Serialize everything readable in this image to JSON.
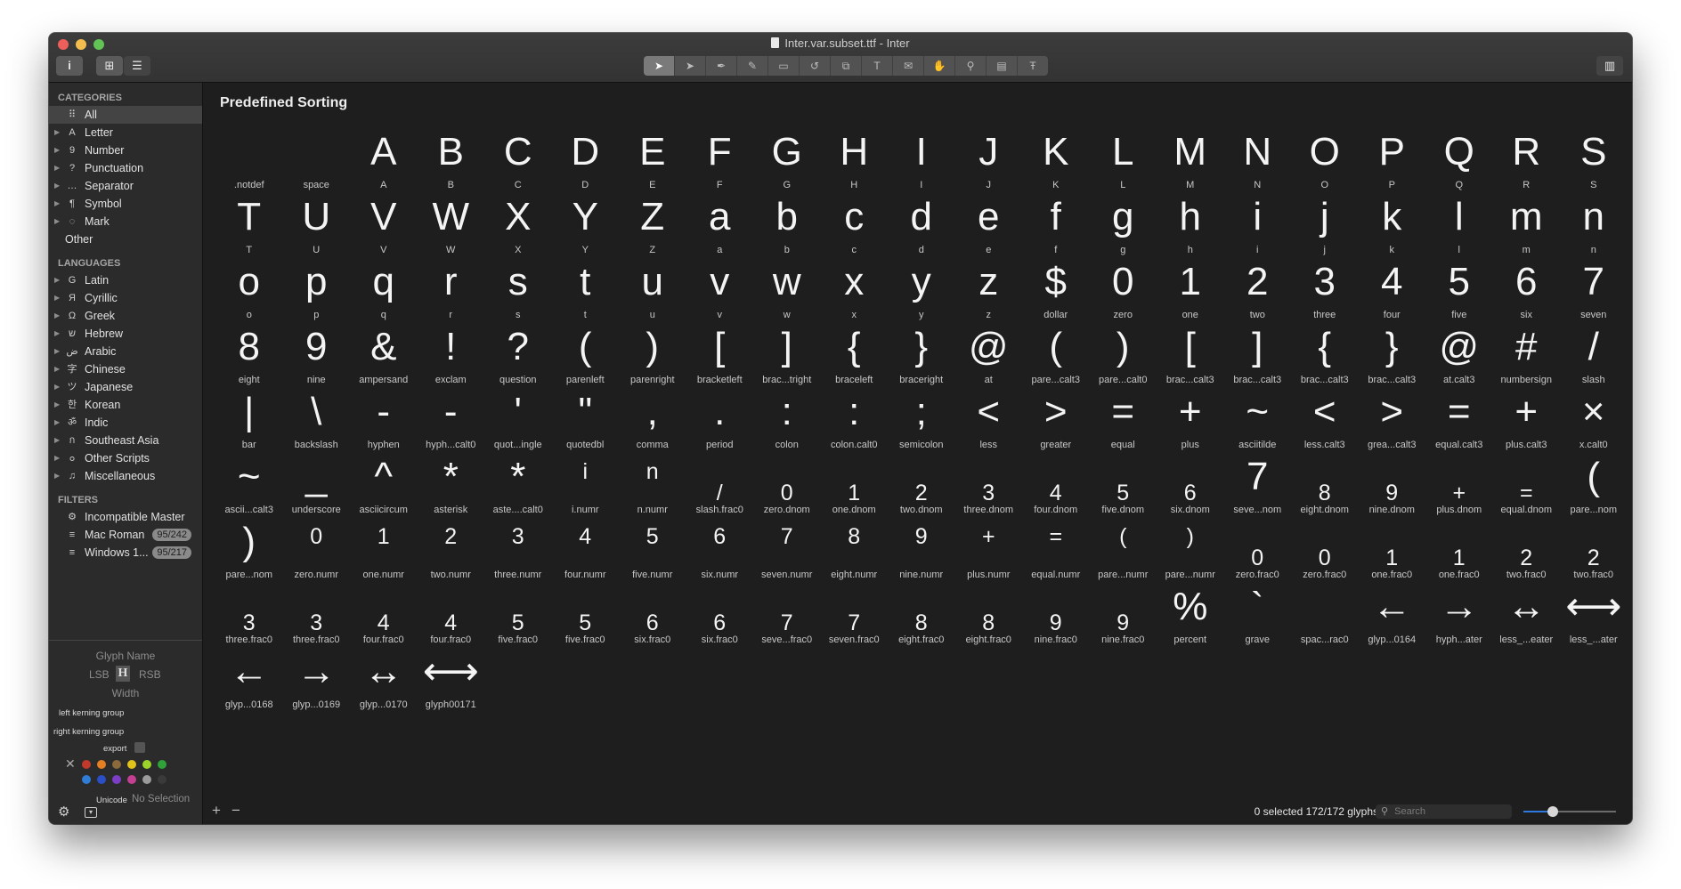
{
  "window": {
    "title": "Inter.var.subset.ttf - Inter"
  },
  "toolbar": {
    "info_label": "i",
    "grid_label": "⊞",
    "list_label": "☰",
    "tools": [
      {
        "name": "select-tool-icon",
        "glyph": "➤",
        "active": true
      },
      {
        "name": "select-all-tool-icon",
        "glyph": "➤",
        "active": false
      },
      {
        "name": "pen-tool-icon",
        "glyph": "✒",
        "active": false
      },
      {
        "name": "pencil-tool-icon",
        "glyph": "✎",
        "active": false
      },
      {
        "name": "rectangle-tool-icon",
        "glyph": "▭",
        "active": false
      },
      {
        "name": "rotate-tool-icon",
        "glyph": "↺",
        "active": false
      },
      {
        "name": "scale-tool-icon",
        "glyph": "⧉",
        "active": false
      },
      {
        "name": "text-tool-icon",
        "glyph": "T",
        "active": false
      },
      {
        "name": "annotation-tool-icon",
        "glyph": "✉",
        "active": false
      },
      {
        "name": "hand-tool-icon",
        "glyph": "✋",
        "active": false
      },
      {
        "name": "zoom-tool-icon",
        "glyph": "⚲",
        "active": false
      },
      {
        "name": "measure-tool-icon",
        "glyph": "▤",
        "active": false
      },
      {
        "name": "type-tool-icon",
        "glyph": "Ŧ",
        "active": false
      }
    ],
    "panel_toggle": "▥"
  },
  "sidebar": {
    "categories_title": "CATEGORIES",
    "categories": [
      {
        "label": "All",
        "icon": "⠿",
        "selected": true,
        "expandable": false
      },
      {
        "label": "Letter",
        "icon": "A",
        "selected": false,
        "expandable": true
      },
      {
        "label": "Number",
        "icon": "9",
        "selected": false,
        "expandable": true
      },
      {
        "label": "Punctuation",
        "icon": "?",
        "selected": false,
        "expandable": true
      },
      {
        "label": "Separator",
        "icon": "…",
        "selected": false,
        "expandable": true
      },
      {
        "label": "Symbol",
        "icon": "¶",
        "selected": false,
        "expandable": true
      },
      {
        "label": "Mark",
        "icon": "◌",
        "selected": false,
        "expandable": true
      }
    ],
    "other_label": "Other",
    "languages_title": "LANGUAGES",
    "languages": [
      {
        "label": "Latin",
        "icon": "G"
      },
      {
        "label": "Cyrillic",
        "icon": "Я"
      },
      {
        "label": "Greek",
        "icon": "Ω"
      },
      {
        "label": "Hebrew",
        "icon": "ש"
      },
      {
        "label": "Arabic",
        "icon": "ض"
      },
      {
        "label": "Chinese",
        "icon": "字"
      },
      {
        "label": "Japanese",
        "icon": "ツ"
      },
      {
        "label": "Korean",
        "icon": "한"
      },
      {
        "label": "Indic",
        "icon": "ॐ"
      },
      {
        "label": "Southeast Asia",
        "icon": "ก"
      },
      {
        "label": "Other Scripts",
        "icon": "ߋ"
      },
      {
        "label": "Miscellaneous",
        "icon": "♫"
      }
    ],
    "filters_title": "FILTERS",
    "filters": [
      {
        "label": "Incompatible Master",
        "icon": "⚙",
        "badge": ""
      },
      {
        "label": "Mac Roman",
        "icon": "≡",
        "badge": "95/242"
      },
      {
        "label": "Windows 1...",
        "icon": "≡",
        "badge": "95/217"
      }
    ]
  },
  "info_panel": {
    "glyph_name": "Glyph Name",
    "lsb": "LSB",
    "rsb": "RSB",
    "width": "Width",
    "left_kerning": "left kerning group",
    "right_kerning": "right kerning group",
    "export_label": "export",
    "unicode_label": "Unicode",
    "unicode_value": "No Selection",
    "color_swatches": [
      "#c0392b",
      "#e67e22",
      "#8a6a3b",
      "#e1c21b",
      "#9bd32b",
      "#2fa33a",
      "#2f7dd6",
      "#2a4fc7",
      "#7c3ec7",
      "#c23f93",
      "#9b9b9b",
      "#3a3a3a"
    ]
  },
  "main": {
    "sort_title": "Predefined Sorting",
    "glyphs": [
      {
        "c": "",
        "n": ".notdef"
      },
      {
        "c": "",
        "n": "space"
      },
      {
        "c": "A",
        "n": "A"
      },
      {
        "c": "B",
        "n": "B"
      },
      {
        "c": "C",
        "n": "C"
      },
      {
        "c": "D",
        "n": "D"
      },
      {
        "c": "E",
        "n": "E"
      },
      {
        "c": "F",
        "n": "F"
      },
      {
        "c": "G",
        "n": "G"
      },
      {
        "c": "H",
        "n": "H"
      },
      {
        "c": "I",
        "n": "I"
      },
      {
        "c": "J",
        "n": "J"
      },
      {
        "c": "K",
        "n": "K"
      },
      {
        "c": "L",
        "n": "L"
      },
      {
        "c": "M",
        "n": "M"
      },
      {
        "c": "N",
        "n": "N"
      },
      {
        "c": "O",
        "n": "O"
      },
      {
        "c": "P",
        "n": "P"
      },
      {
        "c": "Q",
        "n": "Q"
      },
      {
        "c": "R",
        "n": "R"
      },
      {
        "c": "S",
        "n": "S"
      },
      {
        "c": "T",
        "n": "T"
      },
      {
        "c": "U",
        "n": "U"
      },
      {
        "c": "V",
        "n": "V"
      },
      {
        "c": "W",
        "n": "W"
      },
      {
        "c": "X",
        "n": "X"
      },
      {
        "c": "Y",
        "n": "Y"
      },
      {
        "c": "Z",
        "n": "Z"
      },
      {
        "c": "a",
        "n": "a"
      },
      {
        "c": "b",
        "n": "b"
      },
      {
        "c": "c",
        "n": "c"
      },
      {
        "c": "d",
        "n": "d"
      },
      {
        "c": "e",
        "n": "e"
      },
      {
        "c": "f",
        "n": "f"
      },
      {
        "c": "g",
        "n": "g"
      },
      {
        "c": "h",
        "n": "h"
      },
      {
        "c": "i",
        "n": "i"
      },
      {
        "c": "j",
        "n": "j"
      },
      {
        "c": "k",
        "n": "k"
      },
      {
        "c": "l",
        "n": "l"
      },
      {
        "c": "m",
        "n": "m"
      },
      {
        "c": "n",
        "n": "n"
      },
      {
        "c": "o",
        "n": "o"
      },
      {
        "c": "p",
        "n": "p"
      },
      {
        "c": "q",
        "n": "q"
      },
      {
        "c": "r",
        "n": "r"
      },
      {
        "c": "s",
        "n": "s"
      },
      {
        "c": "t",
        "n": "t"
      },
      {
        "c": "u",
        "n": "u"
      },
      {
        "c": "v",
        "n": "v"
      },
      {
        "c": "w",
        "n": "w"
      },
      {
        "c": "x",
        "n": "x"
      },
      {
        "c": "y",
        "n": "y"
      },
      {
        "c": "z",
        "n": "z"
      },
      {
        "c": "$",
        "n": "dollar"
      },
      {
        "c": "0",
        "n": "zero"
      },
      {
        "c": "1",
        "n": "one"
      },
      {
        "c": "2",
        "n": "two"
      },
      {
        "c": "3",
        "n": "three"
      },
      {
        "c": "4",
        "n": "four"
      },
      {
        "c": "5",
        "n": "five"
      },
      {
        "c": "6",
        "n": "six"
      },
      {
        "c": "7",
        "n": "seven"
      },
      {
        "c": "8",
        "n": "eight"
      },
      {
        "c": "9",
        "n": "nine"
      },
      {
        "c": "&",
        "n": "ampersand"
      },
      {
        "c": "!",
        "n": "exclam"
      },
      {
        "c": "?",
        "n": "question"
      },
      {
        "c": "(",
        "n": "parenleft"
      },
      {
        "c": ")",
        "n": "parenright"
      },
      {
        "c": "[",
        "n": "bracketleft"
      },
      {
        "c": "]",
        "n": "brac...tright"
      },
      {
        "c": "{",
        "n": "braceleft"
      },
      {
        "c": "}",
        "n": "braceright"
      },
      {
        "c": "@",
        "n": "at"
      },
      {
        "c": "(",
        "n": "pare...calt3"
      },
      {
        "c": ")",
        "n": "pare...calt0"
      },
      {
        "c": "[",
        "n": "brac...calt3"
      },
      {
        "c": "]",
        "n": "brac...calt3"
      },
      {
        "c": "{",
        "n": "brac...calt3"
      },
      {
        "c": "}",
        "n": "brac...calt3"
      },
      {
        "c": "@",
        "n": "at.calt3"
      },
      {
        "c": "#",
        "n": "numbersign"
      },
      {
        "c": "/",
        "n": "slash"
      },
      {
        "c": "|",
        "n": "bar"
      },
      {
        "c": "\\",
        "n": "backslash"
      },
      {
        "c": "-",
        "n": "hyphen"
      },
      {
        "c": "-",
        "n": "hyph...calt0"
      },
      {
        "c": "'",
        "n": "quot...ingle"
      },
      {
        "c": "\"",
        "n": "quotedbl"
      },
      {
        "c": ",",
        "n": "comma"
      },
      {
        "c": ".",
        "n": "period"
      },
      {
        "c": ":",
        "n": "colon"
      },
      {
        "c": ":",
        "n": "colon.calt0"
      },
      {
        "c": ";",
        "n": "semicolon"
      },
      {
        "c": "<",
        "n": "less"
      },
      {
        "c": ">",
        "n": "greater"
      },
      {
        "c": "=",
        "n": "equal"
      },
      {
        "c": "+",
        "n": "plus"
      },
      {
        "c": "~",
        "n": "asciitilde"
      },
      {
        "c": "<",
        "n": "less.calt3"
      },
      {
        "c": ">",
        "n": "grea...calt3"
      },
      {
        "c": "=",
        "n": "equal.calt3"
      },
      {
        "c": "+",
        "n": "plus.calt3"
      },
      {
        "c": "×",
        "n": "x.calt0"
      },
      {
        "c": "~",
        "n": "ascii...calt3"
      },
      {
        "c": "_",
        "n": "underscore"
      },
      {
        "c": "^",
        "n": "asciicircum"
      },
      {
        "c": "*",
        "n": "asterisk"
      },
      {
        "c": "*",
        "n": "aste....calt0"
      },
      {
        "c": "i",
        "n": "i.numr"
      },
      {
        "c": "n",
        "n": "n.numr"
      },
      {
        "c": "/",
        "n": "slash.frac0"
      },
      {
        "c": "0",
        "n": "zero.dnom"
      },
      {
        "c": "1",
        "n": "one.dnom"
      },
      {
        "c": "2",
        "n": "two.dnom"
      },
      {
        "c": "3",
        "n": "three.dnom"
      },
      {
        "c": "4",
        "n": "four.dnom"
      },
      {
        "c": "5",
        "n": "five.dnom"
      },
      {
        "c": "6",
        "n": "six.dnom"
      },
      {
        "c": "7",
        "n": "seve...nom"
      },
      {
        "c": "8",
        "n": "eight.dnom"
      },
      {
        "c": "9",
        "n": "nine.dnom"
      },
      {
        "c": "+",
        "n": "plus.dnom"
      },
      {
        "c": "=",
        "n": "equal.dnom"
      },
      {
        "c": "(",
        "n": "pare...nom"
      },
      {
        "c": ")",
        "n": "pare...nom"
      },
      {
        "c": "0",
        "n": "zero.numr"
      },
      {
        "c": "1",
        "n": "one.numr"
      },
      {
        "c": "2",
        "n": "two.numr"
      },
      {
        "c": "3",
        "n": "three.numr"
      },
      {
        "c": "4",
        "n": "four.numr"
      },
      {
        "c": "5",
        "n": "five.numr"
      },
      {
        "c": "6",
        "n": "six.numr"
      },
      {
        "c": "7",
        "n": "seven.numr"
      },
      {
        "c": "8",
        "n": "eight.numr"
      },
      {
        "c": "9",
        "n": "nine.numr"
      },
      {
        "c": "+",
        "n": "plus.numr"
      },
      {
        "c": "=",
        "n": "equal.numr"
      },
      {
        "c": "(",
        "n": "pare...numr"
      },
      {
        "c": ")",
        "n": "pare...numr"
      },
      {
        "c": "0",
        "n": "zero.frac0"
      },
      {
        "c": "0",
        "n": "zero.frac0"
      },
      {
        "c": "1",
        "n": "one.frac0"
      },
      {
        "c": "1",
        "n": "one.frac0"
      },
      {
        "c": "2",
        "n": "two.frac0"
      },
      {
        "c": "2",
        "n": "two.frac0"
      },
      {
        "c": "3",
        "n": "three.frac0"
      },
      {
        "c": "3",
        "n": "three.frac0"
      },
      {
        "c": "4",
        "n": "four.frac0"
      },
      {
        "c": "4",
        "n": "four.frac0"
      },
      {
        "c": "5",
        "n": "five.frac0"
      },
      {
        "c": "5",
        "n": "five.frac0"
      },
      {
        "c": "6",
        "n": "six.frac0"
      },
      {
        "c": "6",
        "n": "six.frac0"
      },
      {
        "c": "7",
        "n": "seve...frac0"
      },
      {
        "c": "7",
        "n": "seven.frac0"
      },
      {
        "c": "8",
        "n": "eight.frac0"
      },
      {
        "c": "8",
        "n": "eight.frac0"
      },
      {
        "c": "9",
        "n": "nine.frac0"
      },
      {
        "c": "9",
        "n": "nine.frac0"
      },
      {
        "c": "%",
        "n": "percent"
      },
      {
        "c": "`",
        "n": "grave"
      },
      {
        "c": "",
        "n": "spac...rac0"
      },
      {
        "c": "←",
        "n": "glyp...0164"
      },
      {
        "c": "→",
        "n": "hyph...ater"
      },
      {
        "c": "↔",
        "n": "less_...eater"
      },
      {
        "c": "⟷",
        "n": "less_...ater"
      },
      {
        "c": "←",
        "n": "glyp...0168"
      },
      {
        "c": "→",
        "n": "glyp...0169"
      },
      {
        "c": "↔",
        "n": "glyp...0170"
      },
      {
        "c": "⟷",
        "n": "glyph00171"
      }
    ]
  },
  "statusbar": {
    "add_label": "+",
    "remove_label": "−",
    "status": "0 selected 172/172 glyphs",
    "search_placeholder": "Search",
    "zoom_fraction": 0.32
  }
}
